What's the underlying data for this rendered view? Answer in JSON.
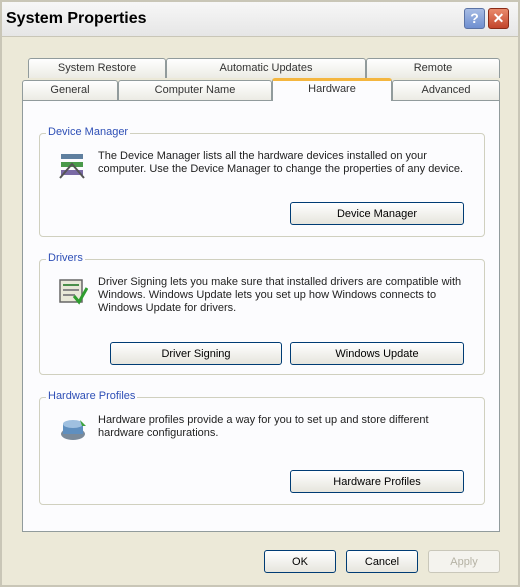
{
  "window": {
    "title": "System Properties"
  },
  "tabs": {
    "row1": [
      "System Restore",
      "Automatic Updates",
      "Remote"
    ],
    "row2": [
      "General",
      "Computer Name",
      "Hardware",
      "Advanced"
    ]
  },
  "device_manager": {
    "title": "Device Manager",
    "description": "The Device Manager lists all the hardware devices installed on your computer. Use the Device Manager to change the properties of any device.",
    "button": "Device Manager"
  },
  "drivers": {
    "title": "Drivers",
    "description": "Driver Signing lets you make sure that installed drivers are compatible with Windows. Windows Update lets you set up how Windows connects to Windows Update for drivers.",
    "signing_button": "Driver Signing",
    "update_button": "Windows Update"
  },
  "hardware_profiles": {
    "title": "Hardware Profiles",
    "description": "Hardware profiles provide a way for you to set up and store different hardware configurations.",
    "button": "Hardware Profiles"
  },
  "footer": {
    "ok": "OK",
    "cancel": "Cancel",
    "apply": "Apply"
  },
  "icons": {
    "device_manager": "device-manager-icon",
    "drivers": "driver-icon",
    "hardware_profiles": "hardware-profiles-icon"
  }
}
